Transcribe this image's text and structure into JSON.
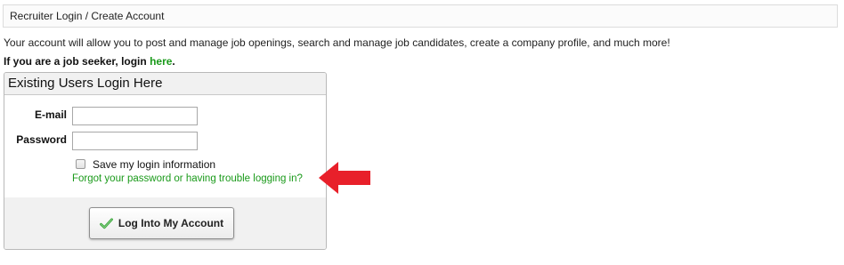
{
  "breadcrumb": {
    "text": "Recruiter Login / Create Account"
  },
  "intro": {
    "text": "Your account will allow you to post and manage job openings, search and manage job candidates, create a company profile, and much more!"
  },
  "seeker": {
    "prefix": "If you are a job seeker, login ",
    "link": "here",
    "suffix": "."
  },
  "login": {
    "title": "Existing Users Login Here",
    "email_label": "E-mail",
    "email_value": "",
    "password_label": "Password",
    "password_value": "",
    "remember_label": "Save my login information",
    "remember_checked": false,
    "forgot_link": "Forgot your password or having trouble logging in?",
    "submit_label": "Log Into My Account"
  },
  "colors": {
    "link_green": "#1a9a1a",
    "annotation_arrow": "#e8202a",
    "panel_gray": "#f1f1f1"
  },
  "icons": {
    "submit_icon": "checkmark-icon",
    "annotation": "left-arrow-icon"
  }
}
